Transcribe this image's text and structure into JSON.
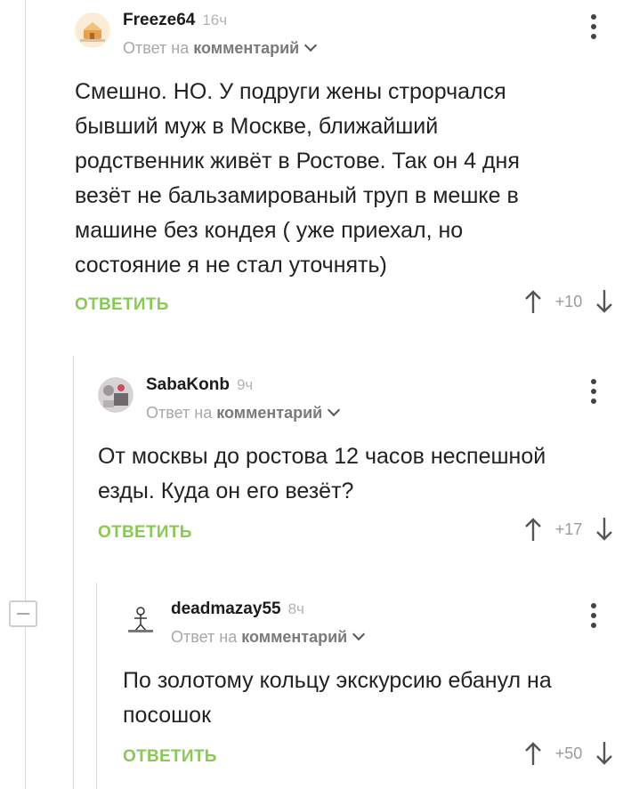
{
  "comments": [
    {
      "user": "Freeze64",
      "time": "16ч",
      "reply_prefix": "Ответ на",
      "reply_target": "комментарий",
      "text": "Смешно. НО. У подруги жены строрчался бывший муж в Москве, ближайший родственник живёт в Ростове. Так он 4 дня везёт не бальзамированый труп в мешке в машине без кондея ( уже приехал, но состояние я не стал уточнять)",
      "reply_label": "ОТВЕТИТЬ",
      "rating": "+10"
    },
    {
      "user": "SabaKonb",
      "time": "9ч",
      "reply_prefix": "Ответ на",
      "reply_target": "комментарий",
      "text": "От москвы до ростова 12 часов неспешной езды. Куда он его везёт?",
      "reply_label": "ОТВЕТИТЬ",
      "rating": "+17"
    },
    {
      "user": "deadmazay55",
      "time": "8ч",
      "reply_prefix": "Ответ на",
      "reply_target": "комментарий",
      "text": "По золотому кольцу экскурсию ебанул на посошок",
      "reply_label": "ОТВЕТИТЬ",
      "rating": "+50"
    }
  ],
  "colors": {
    "accent": "#8ac858",
    "thread_line": "#d8d8d8"
  }
}
